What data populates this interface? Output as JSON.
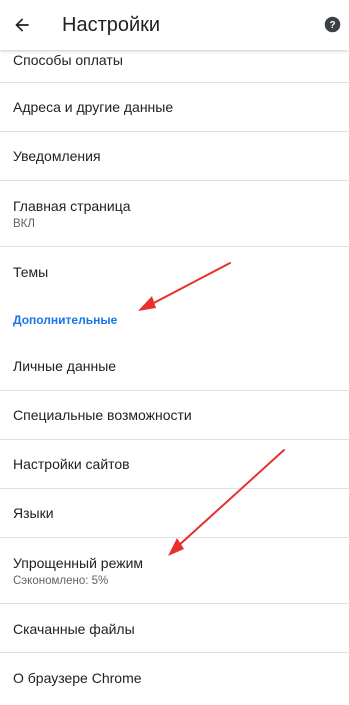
{
  "appbar": {
    "title": "Настройки",
    "back_icon": "arrow-back-icon",
    "help_icon": "help-icon"
  },
  "settings": {
    "payment_methods": "Способы оплаты",
    "addresses": "Адреса и другие данные",
    "notifications": "Уведомления",
    "homepage": "Главная страница",
    "homepage_status": "ВКЛ",
    "themes": "Темы",
    "advanced_header": "Дополнительные",
    "privacy": "Личные данные",
    "accessibility": "Специальные возможности",
    "site_settings": "Настройки сайтов",
    "languages": "Языки",
    "lite_mode": "Упрощенный режим",
    "lite_mode_status": "Сэкономлено: 5%",
    "downloads": "Скачанные файлы",
    "about_chrome": "О браузере Chrome"
  },
  "colors": {
    "accent": "#1a73e8",
    "annotation_arrow": "#e8302a",
    "divider": "#e0e0e0"
  }
}
